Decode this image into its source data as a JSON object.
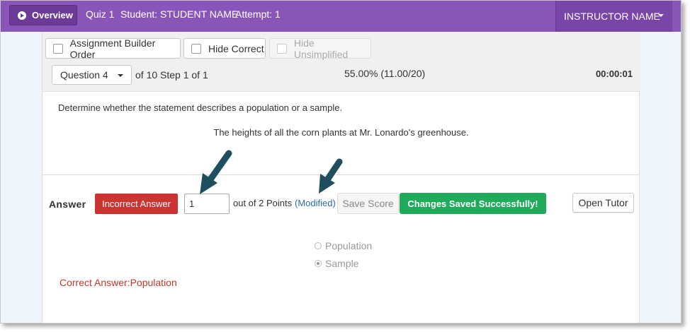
{
  "topbar": {
    "overview_label": "Overview",
    "quiz": "Quiz 1",
    "student": "Student: STUDENT NAME",
    "attempt": "Attempt: 1",
    "instructor": "INSTRUCTOR NAME",
    "color": "#8a55b8"
  },
  "toolbar": {
    "assignment_builder_order": "Assignment Builder Order",
    "hide_correct": "Hide Correct",
    "hide_unsimplified": "Hide Unsimplified",
    "question_selected": "Question 4",
    "step_text": "of 10 Step 1 of 1",
    "score": "55.00% (11.00/20)",
    "timer": "00:00:01"
  },
  "question": {
    "prompt": "Determine whether the statement describes a population or a sample.",
    "statement": "The heights of all the corn plants at Mr. Lonardo's greenhouse.",
    "options": [
      {
        "label": "Population",
        "selected": false
      },
      {
        "label": "Sample",
        "selected": true
      }
    ],
    "correct_answer": "Correct Answer:Population"
  },
  "answer": {
    "label": "Answer",
    "status": "Incorrect Answer",
    "points_value": "1",
    "out_of": "out of 2 Points",
    "modified": "(Modified)",
    "save_score": "Save Score",
    "saved_message": "Changes Saved Successfully!",
    "open_tutor": "Open Tutor",
    "status_color": "#cc3333",
    "saved_color": "#1faa5c"
  },
  "annotations": {
    "arrow_color": "#1f4f5e"
  }
}
